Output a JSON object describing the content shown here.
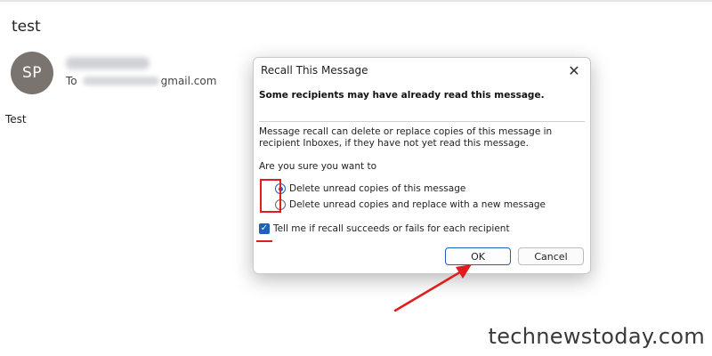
{
  "email": {
    "subject": "test",
    "avatar_initials": "SP",
    "to_label": "To",
    "to_domain": "gmail.com",
    "body": "Test"
  },
  "dialog": {
    "title": "Recall This Message",
    "close_glyph": "✕",
    "warning": "Some recipients may have already read this message.",
    "description": "Message recall can delete or replace copies of this message in recipient Inboxes, if they have not yet read this message.",
    "question": "Are you sure you want to",
    "options": [
      {
        "label": "Delete unread copies of this message",
        "selected": true
      },
      {
        "label": "Delete unread copies and replace with a new message",
        "selected": false
      }
    ],
    "checkbox_label": "Tell me if recall succeeds or fails for each recipient",
    "checkbox_checked": true,
    "ok_label": "OK",
    "cancel_label": "Cancel"
  },
  "watermark": "technewstoday.com",
  "colors": {
    "accent": "#1f5fbf",
    "annotation_red": "#e01c1c",
    "avatar_bg": "#7b736e"
  }
}
